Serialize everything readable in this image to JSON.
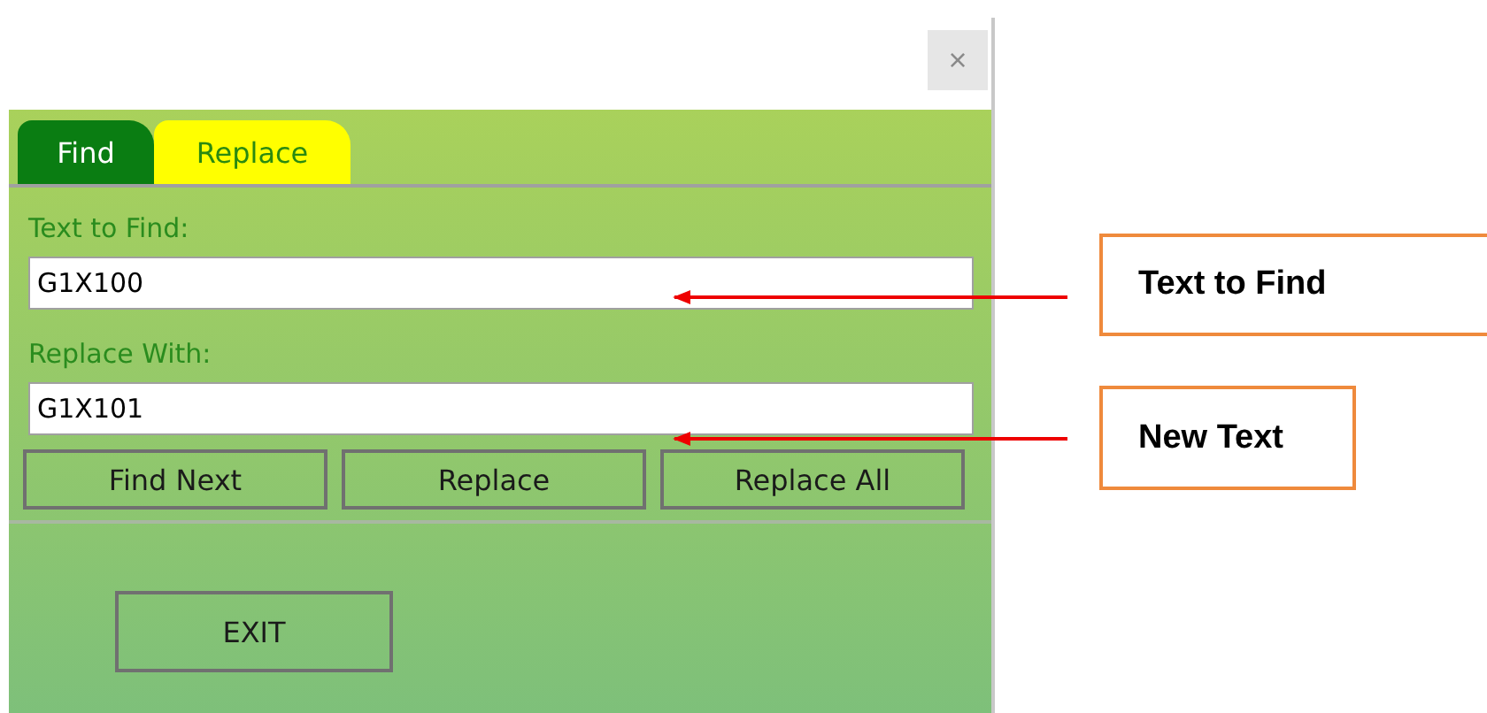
{
  "close_button": {
    "label": "×"
  },
  "tabs": [
    {
      "label": "Find",
      "selected": false
    },
    {
      "label": "Replace",
      "selected": true
    }
  ],
  "fields": [
    {
      "label": "Text to Find:",
      "value": "G1X100"
    },
    {
      "label": "Replace With:",
      "value": "G1X101"
    }
  ],
  "buttons": [
    "Find Next",
    "Replace",
    "Replace All"
  ],
  "exit_button": "EXIT",
  "callouts": [
    {
      "text": "Text to Find"
    },
    {
      "text": "New Text"
    }
  ]
}
